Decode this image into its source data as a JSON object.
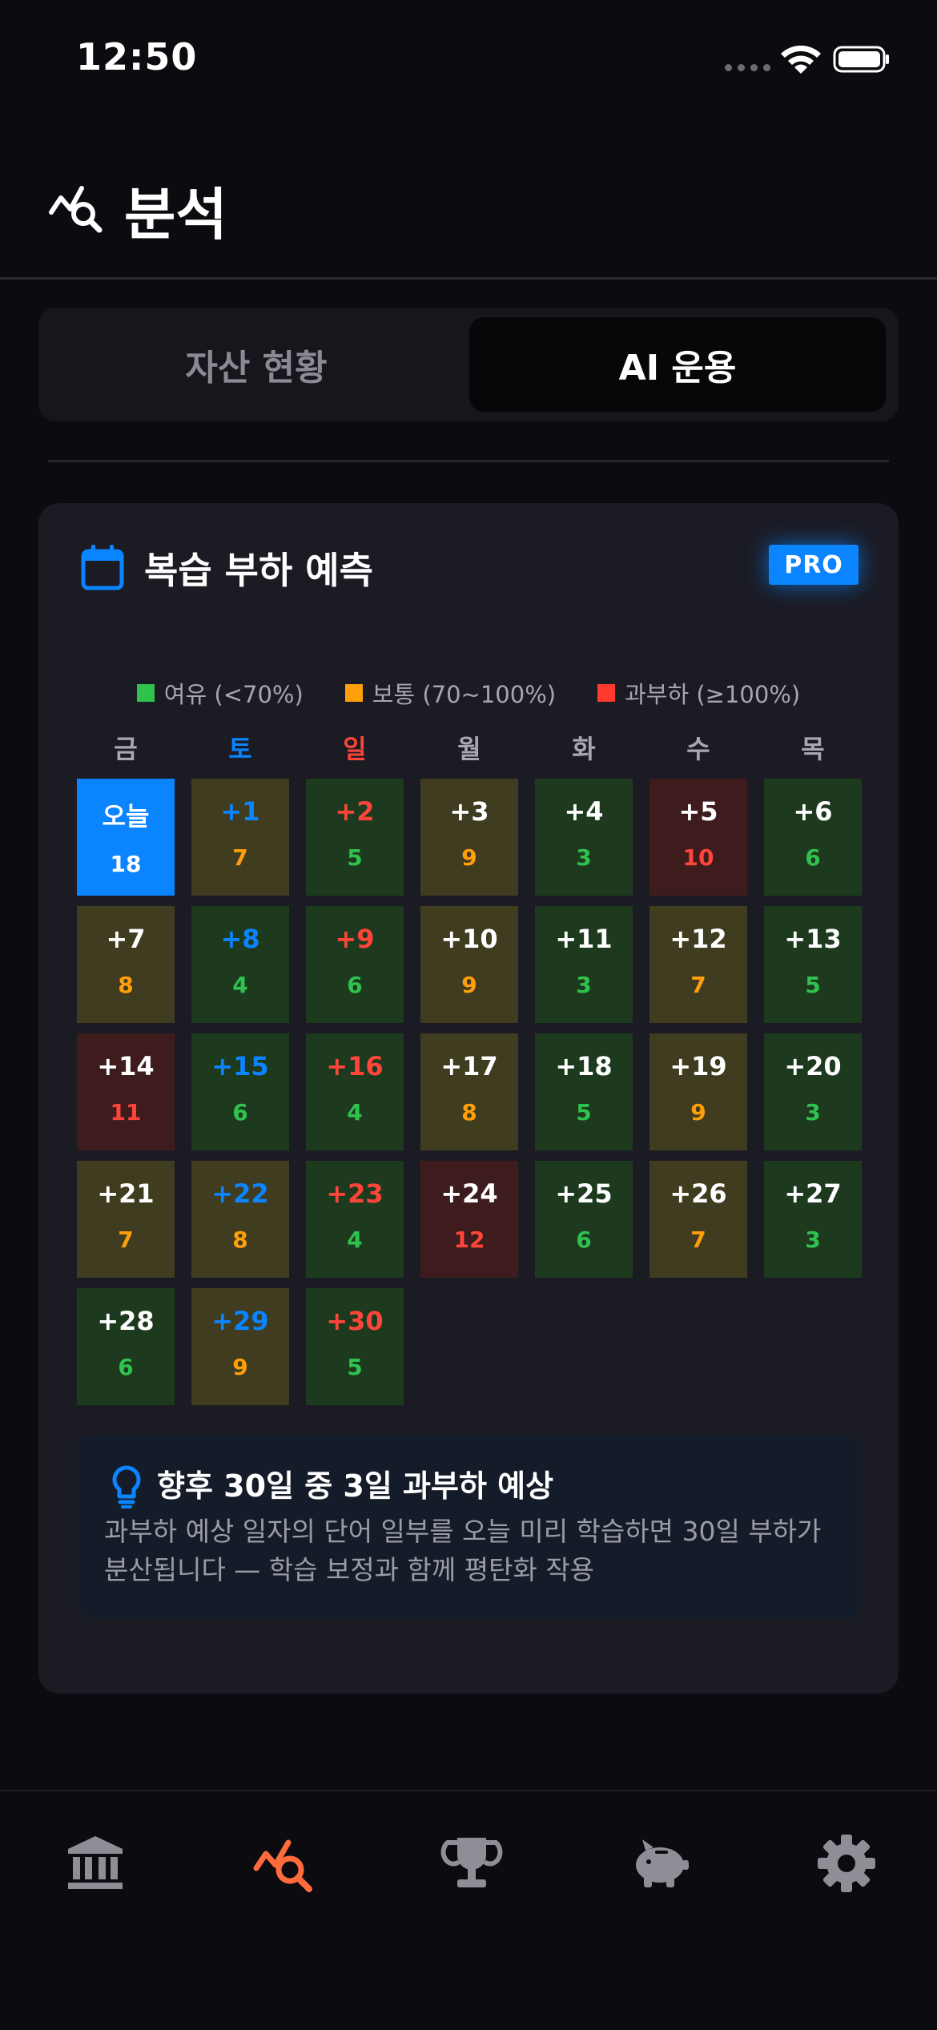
{
  "status_bar": {
    "time": "12:50"
  },
  "header": {
    "title": "분석",
    "icon": "chart-search-icon"
  },
  "segmented": {
    "tabs": [
      {
        "label": "자산 현황",
        "active": false
      },
      {
        "label": "AI 운용",
        "active": true
      }
    ]
  },
  "card": {
    "title": "복습 부하 예측",
    "icon": "calendar-icon",
    "badge": "PRO",
    "legend": [
      {
        "label": "여유 (<70%)",
        "color": "#30c24e"
      },
      {
        "label": "보통 (70~100%)",
        "color": "#ff9f0a"
      },
      {
        "label": "과부하 (≥100%)",
        "color": "#ff3b30"
      }
    ],
    "weekdays": [
      {
        "label": "금",
        "color": "#a8a8b0"
      },
      {
        "label": "토",
        "color": "#0a84ff"
      },
      {
        "label": "일",
        "color": "#ff453a"
      },
      {
        "label": "월",
        "color": "#a8a8b0"
      },
      {
        "label": "화",
        "color": "#a8a8b0"
      },
      {
        "label": "수",
        "color": "#a8a8b0"
      },
      {
        "label": "목",
        "color": "#a8a8b0"
      }
    ],
    "days": [
      {
        "label": "오늘",
        "load": "18",
        "status": "today"
      },
      {
        "label": "+1",
        "load": "7",
        "status": "normal"
      },
      {
        "label": "+2",
        "load": "5",
        "status": "relaxed"
      },
      {
        "label": "+3",
        "load": "9",
        "status": "normal"
      },
      {
        "label": "+4",
        "load": "3",
        "status": "relaxed"
      },
      {
        "label": "+5",
        "load": "10",
        "status": "overload"
      },
      {
        "label": "+6",
        "load": "6",
        "status": "relaxed"
      },
      {
        "label": "+7",
        "load": "8",
        "status": "normal"
      },
      {
        "label": "+8",
        "load": "4",
        "status": "relaxed"
      },
      {
        "label": "+9",
        "load": "6",
        "status": "relaxed"
      },
      {
        "label": "+10",
        "load": "9",
        "status": "normal"
      },
      {
        "label": "+11",
        "load": "3",
        "status": "relaxed"
      },
      {
        "label": "+12",
        "load": "7",
        "status": "normal"
      },
      {
        "label": "+13",
        "load": "5",
        "status": "relaxed"
      },
      {
        "label": "+14",
        "load": "11",
        "status": "overload"
      },
      {
        "label": "+15",
        "load": "6",
        "status": "relaxed"
      },
      {
        "label": "+16",
        "load": "4",
        "status": "relaxed"
      },
      {
        "label": "+17",
        "load": "8",
        "status": "normal"
      },
      {
        "label": "+18",
        "load": "5",
        "status": "relaxed"
      },
      {
        "label": "+19",
        "load": "9",
        "status": "normal"
      },
      {
        "label": "+20",
        "load": "3",
        "status": "relaxed"
      },
      {
        "label": "+21",
        "load": "7",
        "status": "normal"
      },
      {
        "label": "+22",
        "load": "8",
        "status": "normal"
      },
      {
        "label": "+23",
        "load": "4",
        "status": "relaxed"
      },
      {
        "label": "+24",
        "load": "12",
        "status": "overload"
      },
      {
        "label": "+25",
        "load": "6",
        "status": "relaxed"
      },
      {
        "label": "+26",
        "load": "7",
        "status": "normal"
      },
      {
        "label": "+27",
        "load": "3",
        "status": "relaxed"
      },
      {
        "label": "+28",
        "load": "6",
        "status": "relaxed"
      },
      {
        "label": "+29",
        "load": "9",
        "status": "normal"
      },
      {
        "label": "+30",
        "load": "5",
        "status": "relaxed"
      }
    ],
    "tip": {
      "icon": "lightbulb-icon",
      "title": "향후 30일 중 3일 과부하 예상",
      "body": "과부하 예상 일자의 단어 일부를 오늘 미리 학습하면 30일 부하가 분산됩니다 — 학습 보정과 함께 평탄화 작용"
    }
  },
  "tabbar": {
    "items": [
      {
        "icon": "bank-icon",
        "active": false
      },
      {
        "icon": "chart-search-icon",
        "active": true
      },
      {
        "icon": "trophy-icon",
        "active": false
      },
      {
        "icon": "piggy-bank-icon",
        "active": false
      },
      {
        "icon": "gear-icon",
        "active": false
      }
    ],
    "active_color": "#ff6b3d",
    "inactive_color": "#8e8e96"
  },
  "colors": {
    "cell_relaxed": "#1d3a1f",
    "cell_normal": "#3f3c20",
    "cell_overload": "#3e1c1e",
    "cell_today": "#0a84ff",
    "text_relaxed": "#30c24e",
    "text_normal": "#ff9f0a",
    "text_overload": "#ff453a"
  }
}
